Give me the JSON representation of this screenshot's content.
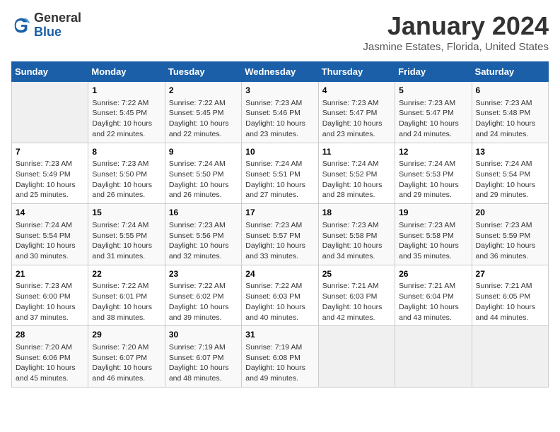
{
  "header": {
    "logo_general": "General",
    "logo_blue": "Blue",
    "title": "January 2024",
    "subtitle": "Jasmine Estates, Florida, United States"
  },
  "days_of_week": [
    "Sunday",
    "Monday",
    "Tuesday",
    "Wednesday",
    "Thursday",
    "Friday",
    "Saturday"
  ],
  "weeks": [
    [
      {
        "num": "",
        "info": ""
      },
      {
        "num": "1",
        "info": "Sunrise: 7:22 AM\nSunset: 5:45 PM\nDaylight: 10 hours\nand 22 minutes."
      },
      {
        "num": "2",
        "info": "Sunrise: 7:22 AM\nSunset: 5:45 PM\nDaylight: 10 hours\nand 22 minutes."
      },
      {
        "num": "3",
        "info": "Sunrise: 7:23 AM\nSunset: 5:46 PM\nDaylight: 10 hours\nand 23 minutes."
      },
      {
        "num": "4",
        "info": "Sunrise: 7:23 AM\nSunset: 5:47 PM\nDaylight: 10 hours\nand 23 minutes."
      },
      {
        "num": "5",
        "info": "Sunrise: 7:23 AM\nSunset: 5:47 PM\nDaylight: 10 hours\nand 24 minutes."
      },
      {
        "num": "6",
        "info": "Sunrise: 7:23 AM\nSunset: 5:48 PM\nDaylight: 10 hours\nand 24 minutes."
      }
    ],
    [
      {
        "num": "7",
        "info": "Sunrise: 7:23 AM\nSunset: 5:49 PM\nDaylight: 10 hours\nand 25 minutes."
      },
      {
        "num": "8",
        "info": "Sunrise: 7:23 AM\nSunset: 5:50 PM\nDaylight: 10 hours\nand 26 minutes."
      },
      {
        "num": "9",
        "info": "Sunrise: 7:24 AM\nSunset: 5:50 PM\nDaylight: 10 hours\nand 26 minutes."
      },
      {
        "num": "10",
        "info": "Sunrise: 7:24 AM\nSunset: 5:51 PM\nDaylight: 10 hours\nand 27 minutes."
      },
      {
        "num": "11",
        "info": "Sunrise: 7:24 AM\nSunset: 5:52 PM\nDaylight: 10 hours\nand 28 minutes."
      },
      {
        "num": "12",
        "info": "Sunrise: 7:24 AM\nSunset: 5:53 PM\nDaylight: 10 hours\nand 29 minutes."
      },
      {
        "num": "13",
        "info": "Sunrise: 7:24 AM\nSunset: 5:54 PM\nDaylight: 10 hours\nand 29 minutes."
      }
    ],
    [
      {
        "num": "14",
        "info": "Sunrise: 7:24 AM\nSunset: 5:54 PM\nDaylight: 10 hours\nand 30 minutes."
      },
      {
        "num": "15",
        "info": "Sunrise: 7:24 AM\nSunset: 5:55 PM\nDaylight: 10 hours\nand 31 minutes."
      },
      {
        "num": "16",
        "info": "Sunrise: 7:23 AM\nSunset: 5:56 PM\nDaylight: 10 hours\nand 32 minutes."
      },
      {
        "num": "17",
        "info": "Sunrise: 7:23 AM\nSunset: 5:57 PM\nDaylight: 10 hours\nand 33 minutes."
      },
      {
        "num": "18",
        "info": "Sunrise: 7:23 AM\nSunset: 5:58 PM\nDaylight: 10 hours\nand 34 minutes."
      },
      {
        "num": "19",
        "info": "Sunrise: 7:23 AM\nSunset: 5:58 PM\nDaylight: 10 hours\nand 35 minutes."
      },
      {
        "num": "20",
        "info": "Sunrise: 7:23 AM\nSunset: 5:59 PM\nDaylight: 10 hours\nand 36 minutes."
      }
    ],
    [
      {
        "num": "21",
        "info": "Sunrise: 7:23 AM\nSunset: 6:00 PM\nDaylight: 10 hours\nand 37 minutes."
      },
      {
        "num": "22",
        "info": "Sunrise: 7:22 AM\nSunset: 6:01 PM\nDaylight: 10 hours\nand 38 minutes."
      },
      {
        "num": "23",
        "info": "Sunrise: 7:22 AM\nSunset: 6:02 PM\nDaylight: 10 hours\nand 39 minutes."
      },
      {
        "num": "24",
        "info": "Sunrise: 7:22 AM\nSunset: 6:03 PM\nDaylight: 10 hours\nand 40 minutes."
      },
      {
        "num": "25",
        "info": "Sunrise: 7:21 AM\nSunset: 6:03 PM\nDaylight: 10 hours\nand 42 minutes."
      },
      {
        "num": "26",
        "info": "Sunrise: 7:21 AM\nSunset: 6:04 PM\nDaylight: 10 hours\nand 43 minutes."
      },
      {
        "num": "27",
        "info": "Sunrise: 7:21 AM\nSunset: 6:05 PM\nDaylight: 10 hours\nand 44 minutes."
      }
    ],
    [
      {
        "num": "28",
        "info": "Sunrise: 7:20 AM\nSunset: 6:06 PM\nDaylight: 10 hours\nand 45 minutes."
      },
      {
        "num": "29",
        "info": "Sunrise: 7:20 AM\nSunset: 6:07 PM\nDaylight: 10 hours\nand 46 minutes."
      },
      {
        "num": "30",
        "info": "Sunrise: 7:19 AM\nSunset: 6:07 PM\nDaylight: 10 hours\nand 48 minutes."
      },
      {
        "num": "31",
        "info": "Sunrise: 7:19 AM\nSunset: 6:08 PM\nDaylight: 10 hours\nand 49 minutes."
      },
      {
        "num": "",
        "info": ""
      },
      {
        "num": "",
        "info": ""
      },
      {
        "num": "",
        "info": ""
      }
    ]
  ]
}
